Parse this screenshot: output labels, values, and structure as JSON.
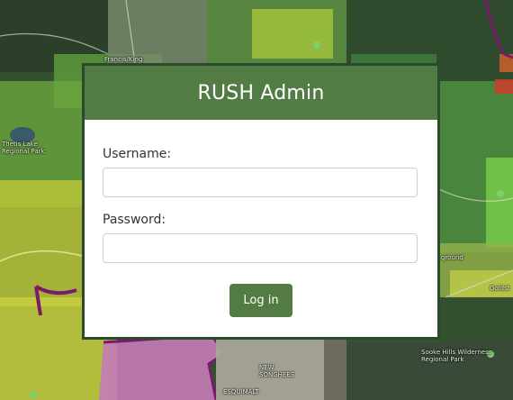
{
  "login": {
    "title": "RUSH Admin",
    "username_label": "Username:",
    "username_value": "",
    "password_label": "Password:",
    "password_value": "",
    "submit_label": "Log in"
  },
  "map": {
    "labels": {
      "francis_king": "Francis/King",
      "thetis_lake": "Thetis Lake\nRegional Park",
      "sooke_hills": "Sooke Hills Wilderness\nRegional Park",
      "goldstream": "Goldst",
      "ground": "ground",
      "new_songhees": "NEW\nSONGHEES",
      "esquimalt": "ESQUIMALT"
    }
  },
  "colors": {
    "accent": "#527c43",
    "border": "#2a4a2e"
  }
}
